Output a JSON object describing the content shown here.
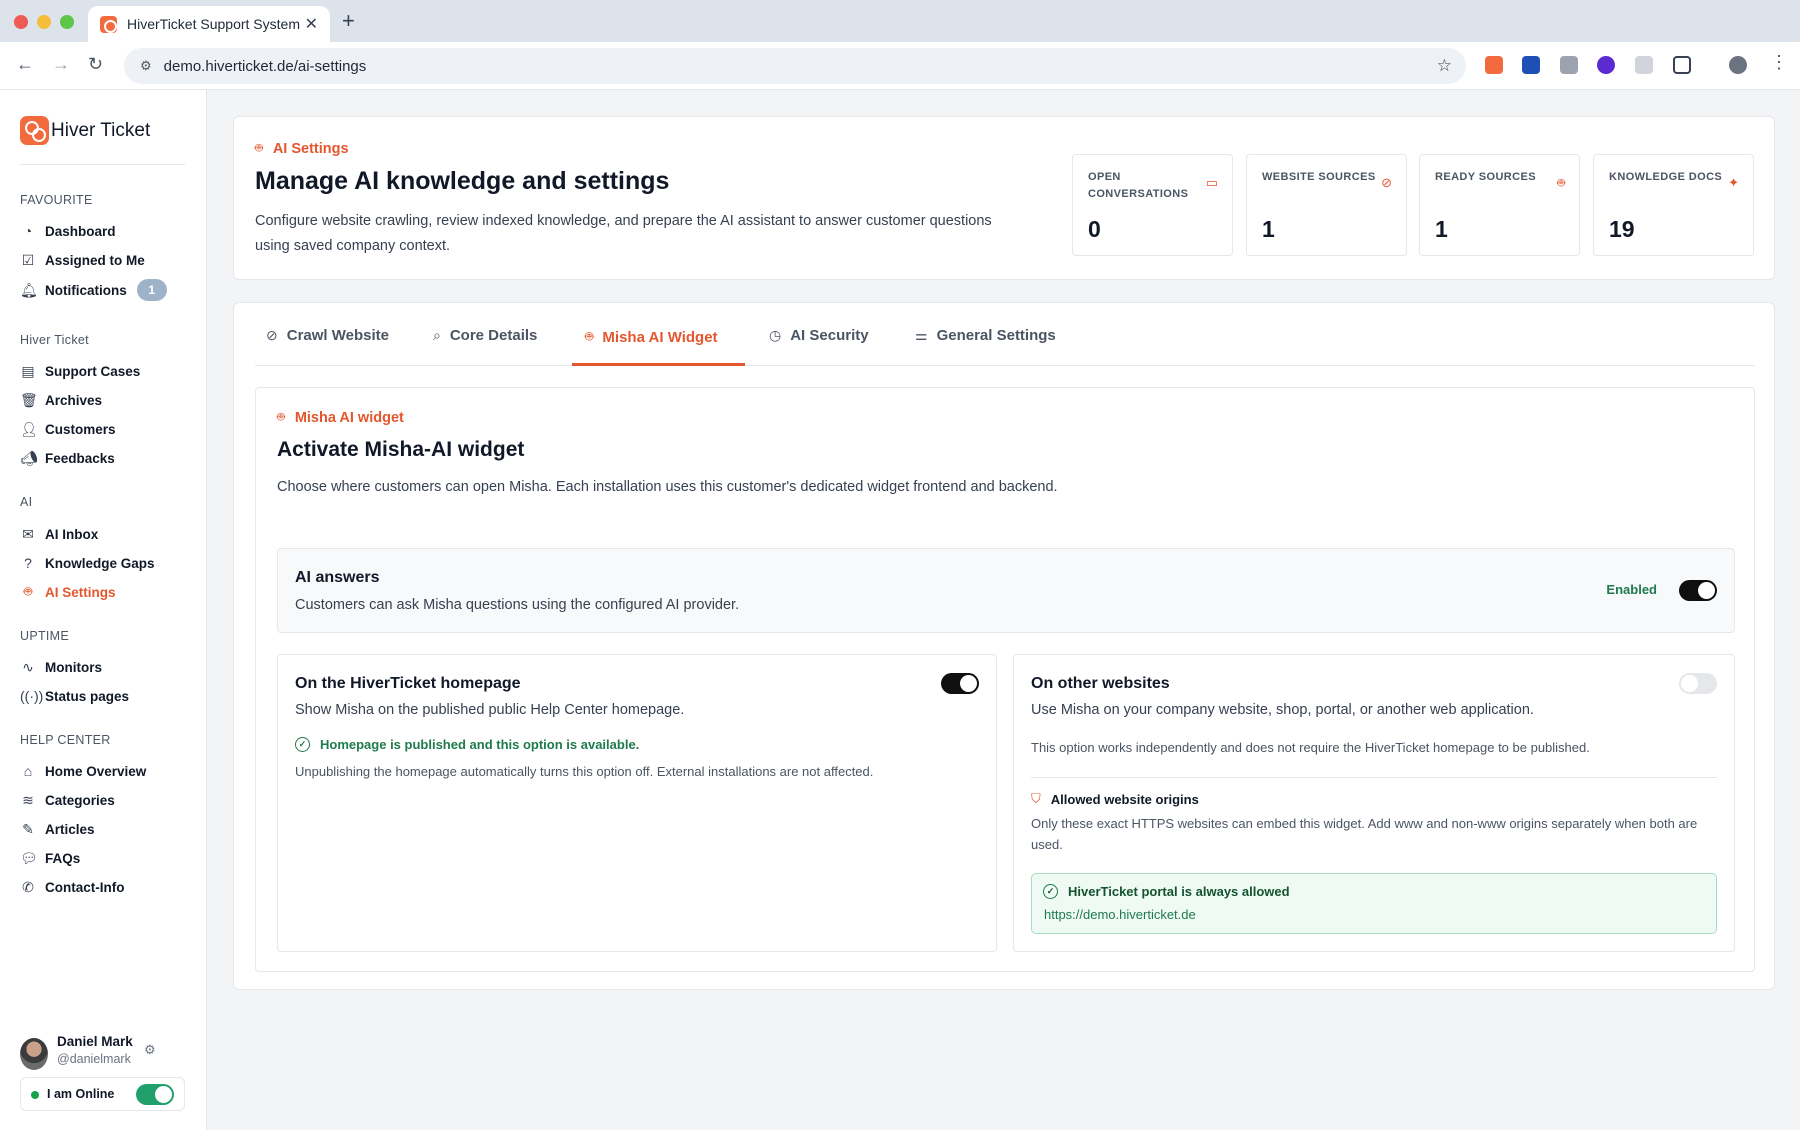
{
  "browser": {
    "tab_title": "HiverTicket Support System",
    "tab_close": "✕",
    "new_tab": "+",
    "url": "demo.hiverticket.de/ai-settings"
  },
  "sidebar": {
    "brand": "Hiver Ticket",
    "sections": {
      "favourite": "FAVOURITE",
      "hiver": "Hiver Ticket",
      "ai": "AI",
      "uptime": "UPTIME",
      "help": "HELP CENTER"
    },
    "items": {
      "dashboard": "Dashboard",
      "assigned": "Assigned to Me",
      "notifications": "Notifications",
      "notifications_count": "1",
      "support_cases": "Support Cases",
      "archives": "Archives",
      "customers": "Customers",
      "feedbacks": "Feedbacks",
      "ai_inbox": "AI Inbox",
      "knowledge_gaps": "Knowledge Gaps",
      "ai_settings": "AI Settings",
      "monitors": "Monitors",
      "status_pages": "Status pages",
      "home_overview": "Home Overview",
      "categories": "Categories",
      "articles": "Articles",
      "faqs": "FAQs",
      "contact_info": "Contact-Info"
    },
    "user": {
      "name": "Daniel Mark",
      "handle": "@danielmark",
      "status": "I am Online",
      "online": true
    }
  },
  "header": {
    "kicker": "AI Settings",
    "title": "Manage AI knowledge and settings",
    "description": "Configure website crawling, review indexed knowledge, and prepare the AI assistant to answer customer questions using saved company context.",
    "stats": [
      {
        "label": "OPEN CONVERSATIONS",
        "value": "0",
        "icon": "chat-icon"
      },
      {
        "label": "WEBSITE SOURCES",
        "value": "1",
        "icon": "globe-icon"
      },
      {
        "label": "READY SOURCES",
        "value": "1",
        "icon": "bot-icon"
      },
      {
        "label": "KNOWLEDGE DOCS",
        "value": "19",
        "icon": "sparkle-icon"
      }
    ]
  },
  "tabs": [
    {
      "label": "Crawl Website",
      "icon": "globe-icon"
    },
    {
      "label": "Core Details",
      "icon": "search-icon"
    },
    {
      "label": "Misha AI Widget",
      "icon": "bot-icon",
      "active": true
    },
    {
      "label": "AI Security",
      "icon": "clock-icon"
    },
    {
      "label": "General Settings",
      "icon": "sliders-icon"
    }
  ],
  "widget": {
    "kicker": "Misha AI widget",
    "title": "Activate Misha-AI widget",
    "description": "Choose where customers can open Misha. Each installation uses this customer's dedicated widget frontend and backend.",
    "ai_answers": {
      "title": "AI answers",
      "description": "Customers can ask Misha questions using the configured AI provider.",
      "status": "Enabled",
      "enabled": true
    },
    "homepage": {
      "title": "On the HiverTicket homepage",
      "description": "Show Misha on the published public Help Center homepage.",
      "enabled": true,
      "ok_text": "Homepage is published and this option is available.",
      "note": "Unpublishing the homepage automatically turns this option off. External installations are not affected."
    },
    "other_sites": {
      "title": "On other websites",
      "description": "Use Misha on your company website, shop, portal, or another web application.",
      "enabled": false,
      "note": "This option works independently and does not require the HiverTicket homepage to be published.",
      "origins_title": "Allowed website origins",
      "origins_desc": "Only these exact HTTPS websites can embed this widget. Add www and non-www origins separately when both are used.",
      "allowed_title": "HiverTicket portal is always allowed",
      "allowed_url": "https://demo.hiverticket.de"
    }
  },
  "colors": {
    "accent": "#e4572e",
    "success": "#1f7a4d",
    "toggle_on": "#0f0f10"
  }
}
